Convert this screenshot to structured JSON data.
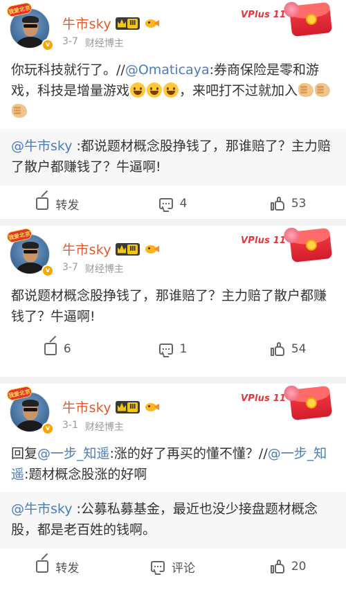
{
  "posts": [
    {
      "author": "牛市sky",
      "pendant_text": "我爱北京",
      "level": "Ⅲ",
      "date": "3-7",
      "tag": "财经博主",
      "vplus_text": "VPlus 11·11",
      "content_pre": "你玩科技就行了。//",
      "content_link": "@Omaticaya",
      "content_mid": ":券商保险是零和游戏，科技是增量游戏",
      "content_post": "，来吧打不过就加入",
      "quote_link": "@牛市sky",
      "quote_text": " :都说题材概念股挣钱了，那谁赔了？主力赔了散户都赚钱了？牛逼啊!",
      "repost_label": "转发",
      "comment_label": "4",
      "like_label": "53"
    },
    {
      "author": "牛市sky",
      "pendant_text": "我爱北京",
      "level": "Ⅲ",
      "date": "3-7",
      "tag": "财经博主",
      "vplus_text": "VPlus 11·11",
      "content": "都说题材概念股挣钱了，那谁赔了？主力赔了散户都赚钱了？牛逼啊!",
      "repost_label": "6",
      "comment_label": "1",
      "like_label": "54"
    },
    {
      "author": "牛市sky",
      "pendant_text": "我爱北京",
      "level": "Ⅲ",
      "date": "3-1",
      "tag": "财经博主",
      "vplus_text": "VPlus 11·11",
      "content_pre": "回复",
      "content_link": "@一步_知遥",
      "content_mid": ":涨的好了再买的懂不懂？//",
      "content_link2": "@一步_知遥",
      "content_post": ":题材概念股涨的好啊",
      "quote_link": "@牛市sky",
      "quote_text": " :公募私募基金，最近也没少接盘题材概念股，都是老百姓的钱啊。",
      "repost_label": "转发",
      "comment_label": "评论",
      "like_label": "20"
    }
  ]
}
